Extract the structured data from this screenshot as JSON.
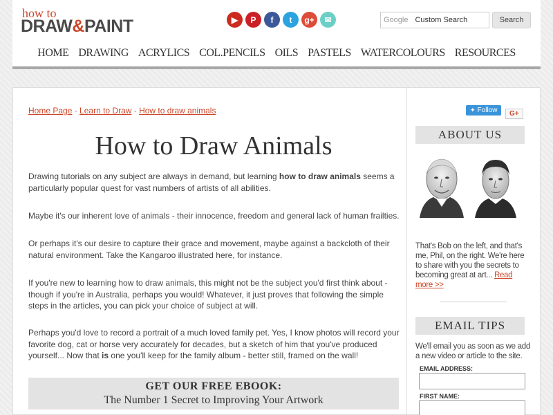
{
  "logo": {
    "top": "how to",
    "left": "DRAW",
    "amp": "&",
    "right": "PAINT"
  },
  "social": [
    {
      "name": "youtube-icon",
      "glyph": "▶",
      "color": "#cc2b20"
    },
    {
      "name": "pinterest-icon",
      "glyph": "P",
      "color": "#cb2027"
    },
    {
      "name": "facebook-icon",
      "glyph": "f",
      "color": "#3b5998"
    },
    {
      "name": "twitter-icon",
      "glyph": "t",
      "color": "#2aa3e0"
    },
    {
      "name": "googleplus-icon",
      "glyph": "g+",
      "color": "#dd4b39"
    },
    {
      "name": "email-icon",
      "glyph": "✉",
      "color": "#6ccfc6"
    }
  ],
  "search": {
    "google_label": "Google",
    "placeholder": "Custom Search",
    "button": "Search"
  },
  "nav": [
    "HOME",
    "DRAWING",
    "ACRYLICS",
    "COL.PENCILS",
    "OILS",
    "PASTELS",
    "WATERCOLOURS",
    "RESOURCES"
  ],
  "breadcrumb": {
    "home": "Home Page",
    "sep1": " - ",
    "learn": "Learn to Draw",
    "sep2": " - ",
    "current": "How to draw animals"
  },
  "title": "How to Draw Animals",
  "paragraphs": {
    "p1a": "Drawing tutorials on any subject are always in demand, but learning ",
    "p1b": "how to draw animals",
    "p1c": " seems a particularly popular quest for vast numbers of artists of all abilities.",
    "p2": "Maybe it's our inherent love of animals - their innocence, freedom and general lack of human frailties.",
    "p3": "Or perhaps it's our desire to capture their grace and movement, maybe against a backcloth of their natural environment. Take the Kangaroo illustrated here, for instance.",
    "p4": "If you're new to learning how to draw animals, this might not be the subject you'd first think about - though if you're in Australia, perhaps you would! Whatever, it just proves that following the simple steps in the articles, you can pick your choice of subject at will.",
    "p5a": "Perhaps you'd love to record a portrait of a much loved family pet. Yes, I know photos will record your favorite dog, cat or horse very accurately for decades, but a sketch of him that you've produced yourself... Now that ",
    "p5b": "is",
    "p5c": " one you'll keep for the family album - better still, framed on the wall!"
  },
  "ebook": {
    "line1": "GET OUR FREE EBOOK:",
    "line2": "The Number 1 Secret to Improving Your Artwork"
  },
  "sidebar": {
    "twitter_follow": "Follow",
    "gplus": "G+",
    "about_heading": "ABOUT US",
    "about_text": "That's Bob on the left, and that's me, Phil, on the right. We're here to share with you the secrets to becoming great at art... ",
    "read_more": "Read more >>",
    "email_heading": "EMAIL TIPS",
    "email_text": "We'll email you as soon as we add a new video or article to the site.",
    "email_label": "EMAIL ADDRESS:",
    "first_name_label": "FIRST NAME:"
  },
  "colors": {
    "accent": "#cc4628",
    "text": "#444444",
    "panel": "#e3e3e3"
  }
}
